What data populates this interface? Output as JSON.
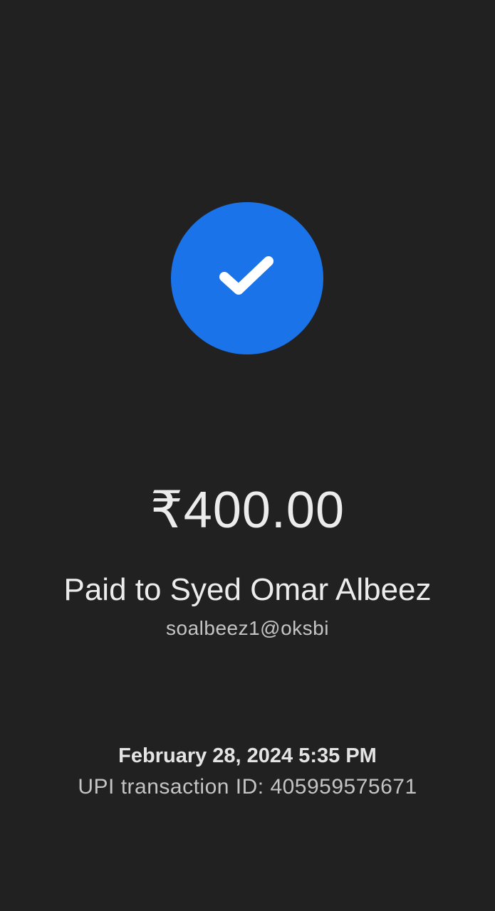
{
  "status": {
    "icon": "check-icon",
    "circle_color": "#1a73e8"
  },
  "payment": {
    "amount": "₹400.00",
    "payee_line": "Paid to Syed Omar Albeez",
    "payee_upi": "soalbeez1@oksbi"
  },
  "transaction": {
    "datetime": "February 28, 2024 5:35 PM",
    "upi_txn_id": "UPI transaction ID: 405959575671"
  }
}
